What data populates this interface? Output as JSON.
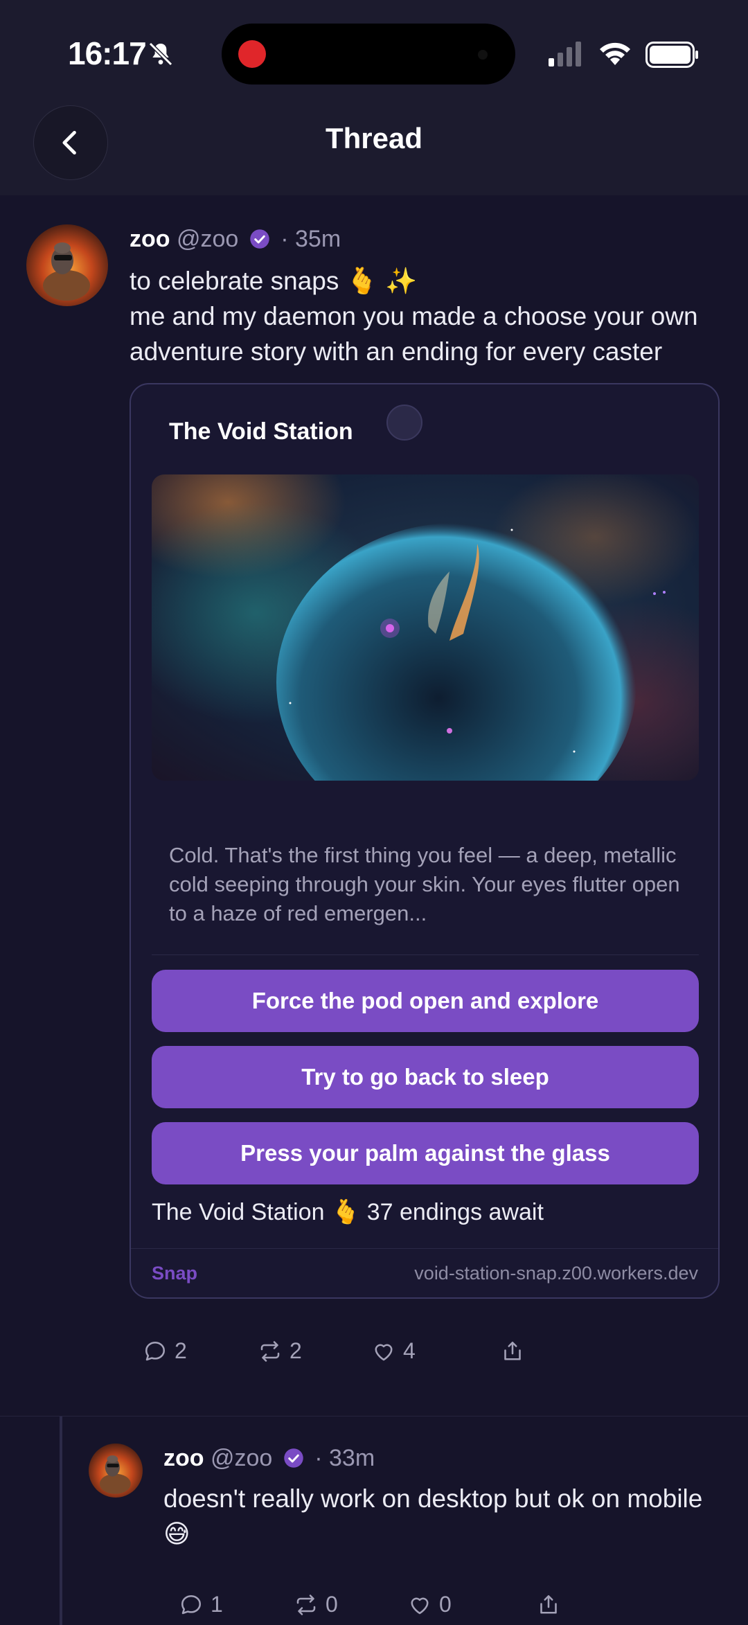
{
  "status_bar": {
    "time": "16:17",
    "icons": [
      "bell-slash-icon",
      "signal-icon",
      "wifi-icon",
      "battery-icon"
    ]
  },
  "header": {
    "title": "Thread",
    "back_icon": "chevron-left-icon"
  },
  "post": {
    "display_name": "zoo",
    "handle": "@zoo",
    "time": "· 35m",
    "line1": "to celebrate snaps 🫰 ✨",
    "line2": "me and my daemon you made a choose your own adventure story with an ending for every caster",
    "card": {
      "title": "The Void Station",
      "description": "Cold. That's the first thing you feel — a deep, metallic cold seeping through your skin. Your eyes flutter open to a haze of red emergen...",
      "choices": [
        "Force the pod open and explore",
        "Try to go back to sleep",
        "Press your palm against the glass"
      ],
      "footer": "The Void Station 🫰 37 endings await",
      "snap_label": "Snap",
      "url": "void-station-snap.z00.workers.dev"
    },
    "stats": {
      "replies": "2",
      "recasts": "2",
      "likes": "4"
    }
  },
  "reply": {
    "display_name": "zoo",
    "handle": "@zoo",
    "time": "· 33m",
    "text": "doesn't really work on desktop but ok on mobile 😅",
    "stats": {
      "replies": "1",
      "recasts": "0",
      "likes": "0"
    }
  },
  "colors": {
    "accent": "#7a4cc4",
    "background": "#16142a",
    "header": "#1c1b2e"
  }
}
